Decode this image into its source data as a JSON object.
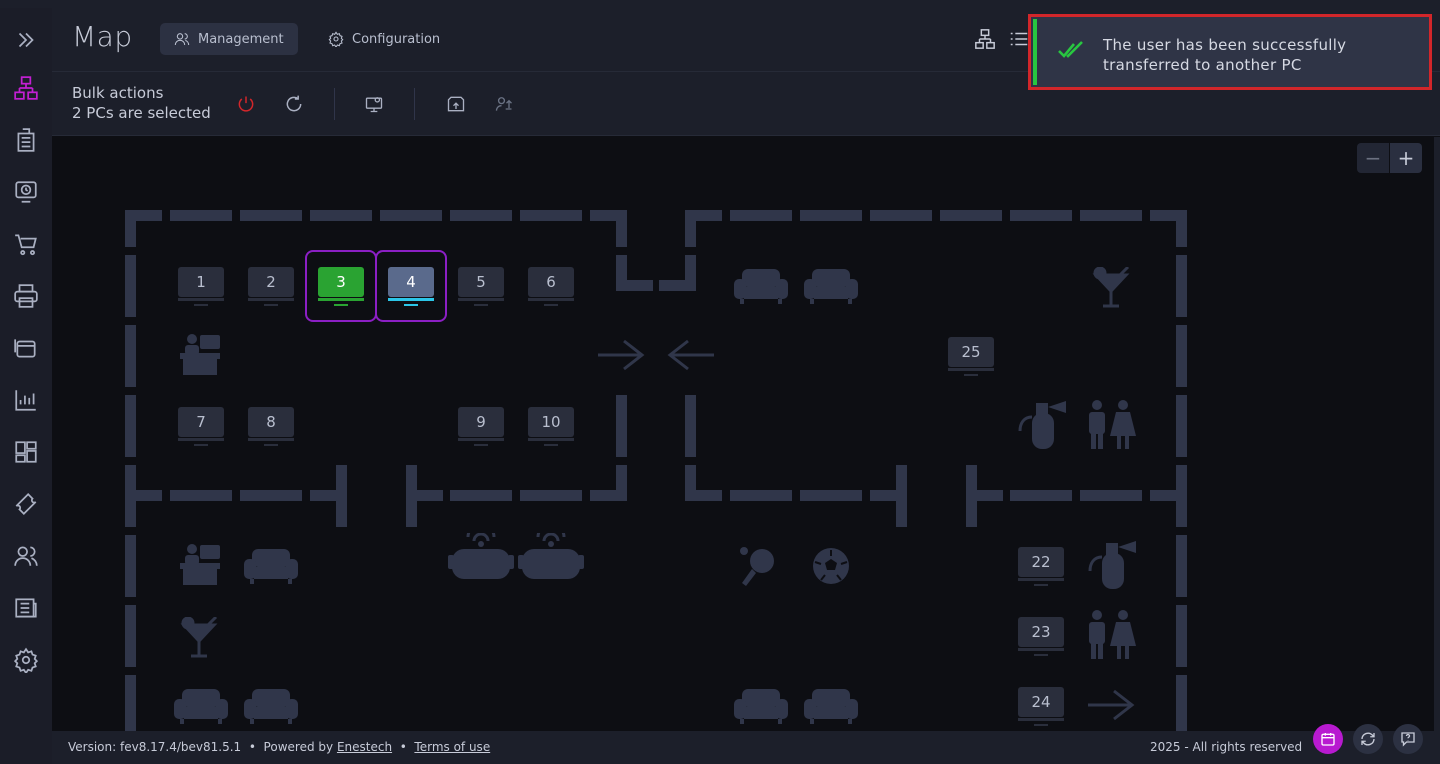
{
  "header": {
    "title": "Map",
    "tabs": [
      {
        "label": "Management",
        "icon": "users-icon",
        "active": true
      },
      {
        "label": "Configuration",
        "icon": "gear-icon",
        "active": false
      }
    ]
  },
  "toolbar": {
    "bulk_title": "Bulk actions",
    "bulk_subtitle": "2 PCs are selected"
  },
  "toast": {
    "message_line1": "The user has been successfully",
    "message_line2": "transferred to another PC",
    "icon": "double-check-icon",
    "accent_color": "#28c740"
  },
  "map": {
    "zoom_out_label": "−",
    "zoom_in_label": "+",
    "pcs": [
      {
        "number": "1",
        "state": "normal"
      },
      {
        "number": "2",
        "state": "normal"
      },
      {
        "number": "3",
        "state": "active-green",
        "selected": true
      },
      {
        "number": "4",
        "state": "active-blue",
        "selected": true
      },
      {
        "number": "5",
        "state": "normal"
      },
      {
        "number": "6",
        "state": "normal"
      },
      {
        "number": "7",
        "state": "normal"
      },
      {
        "number": "8",
        "state": "normal"
      },
      {
        "number": "9",
        "state": "normal"
      },
      {
        "number": "10",
        "state": "normal"
      },
      {
        "number": "25",
        "state": "normal"
      },
      {
        "number": "22",
        "state": "normal"
      },
      {
        "number": "23",
        "state": "normal"
      },
      {
        "number": "24",
        "state": "normal"
      }
    ]
  },
  "footer": {
    "version": "Version: fev8.17.4/bev81.5.1",
    "sep1": "•",
    "powered_by": "Powered by",
    "company": "Enestech",
    "sep2": "•",
    "terms": "Terms of use",
    "copyright": "2025 - All rights reserved"
  },
  "colors": {
    "accent_purple": "#8b1fc4",
    "green_pc": "#2aa332",
    "blue_pc": "#5a6a8c",
    "power_red": "#d2262a",
    "calendar_button": "#b81ad0"
  }
}
